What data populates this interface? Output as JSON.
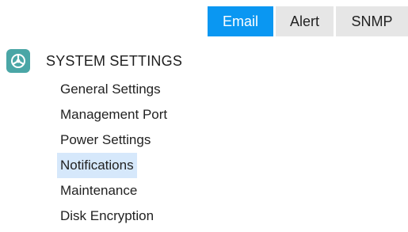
{
  "tabs": [
    {
      "label": "Email",
      "active": true
    },
    {
      "label": "Alert",
      "active": false
    },
    {
      "label": "SNMP",
      "active": false
    }
  ],
  "section": {
    "title": "SYSTEM SETTINGS",
    "icon": "settings-gear-icon"
  },
  "menu": [
    {
      "label": "General Settings"
    },
    {
      "label": "Management Port"
    },
    {
      "label": "Power Settings"
    },
    {
      "label": "Notifications",
      "selected": true
    },
    {
      "label": "Maintenance"
    },
    {
      "label": "Disk Encryption"
    }
  ],
  "colors": {
    "active_tab": "#0a97f2",
    "inactive_tab": "#e6e6e6",
    "icon_bg": "#4aa6a6",
    "selected_item_bg": "#d6e8fb"
  }
}
